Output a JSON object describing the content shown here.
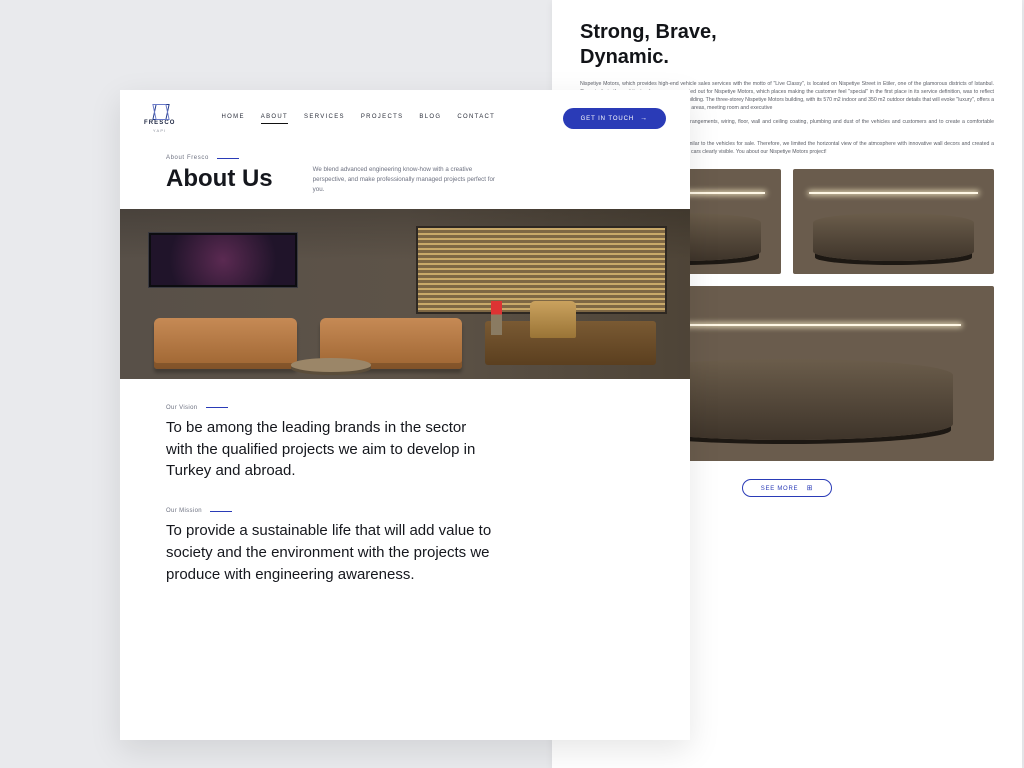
{
  "brand": {
    "name": "FRESCO",
    "sub": "YAPI"
  },
  "nav": {
    "items": [
      "HOME",
      "ABOUT",
      "SERVICES",
      "PROJECTS",
      "BLOG",
      "CONTACT"
    ],
    "active_index": 1,
    "cta_label": "GET IN TOUCH"
  },
  "left": {
    "eyebrow": "About Fresco",
    "title": "About Us",
    "blurb": "We blend advanced engineering know-how with a creative perspective, and make professionally managed projects perfect for you.",
    "vision_label": "Our Vision",
    "vision_text": "To be among the leading brands in the sector with the qualified projects we aim to develop in Turkey and abroad.",
    "mission_label": "Our Mission",
    "mission_text": "To provide a sustainable life that will add value to society and the environment with the projects we produce with engineering awareness."
  },
  "right": {
    "title": "Strong, Brave,\nDynamic.",
    "para1": "Nispetiye Motors, which provides high-end vehicle sales services with the motto of \"Live Classy\", is located on Nispetiye Street in Etiler, one of the glamorous districts of Istanbul. Our priority in the architectural process we carried out for Nispetiye Motors, which places making the customer feel \"special\" in the first place in its service definition, was to reflect this \"special and unique\" state of being to the building. The three-storey Nispetiye Motors building, with its 570 m2 indoor and 350 m2 outdoor details that will evoke \"luxury\", offers a highly functional environment with its open work areas, meeting room and executive",
    "para2": "carefully completed the necessary structural arrangements, wiring, floor, wall and ceiling coating, plumbing and dust of the vehicles and customers and to create a comfortable service area.",
    "para3": "area and showroom look bold and powerful, similar to the vehicles for sale. Therefore, we limited the horizontal view of the atmosphere with innovative wall decors and created a contrast with led panels to make the passion for cars clearly visible. You about our Nispetiye Motors project!",
    "see_more": "SEE MORE"
  }
}
